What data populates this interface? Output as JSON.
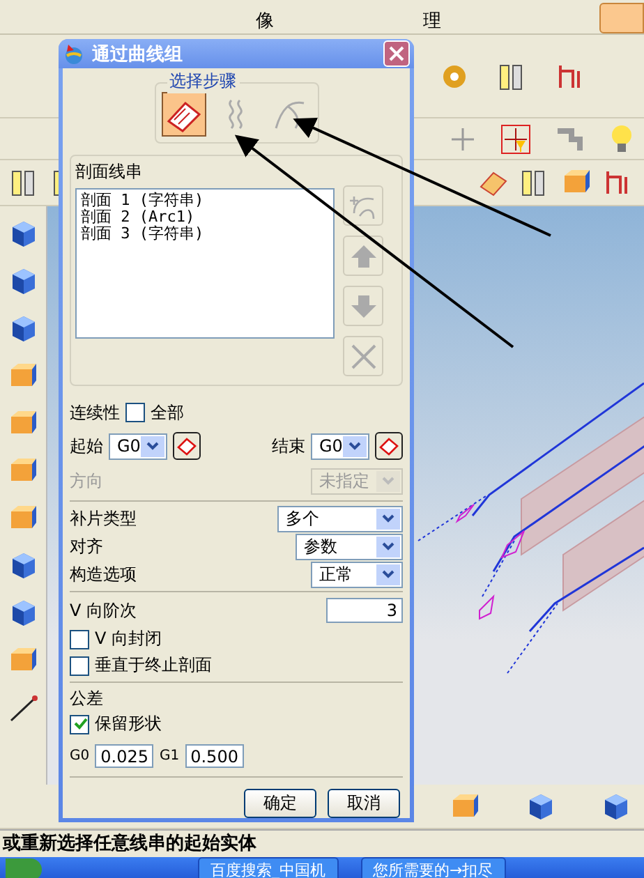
{
  "app": {
    "ribbon_labels": [
      "像",
      "理"
    ],
    "status_text": "或重新选择任意线串的起始实体",
    "taskbar_items": [
      "百度搜索_中国机",
      "您所需要的→扣尽"
    ]
  },
  "dialog": {
    "title": "通过曲线组",
    "steps": {
      "label": "选择步骤",
      "items": [
        {
          "kind": "sheet",
          "selected": true
        },
        {
          "kind": "curves",
          "selected": false
        },
        {
          "kind": "spine",
          "selected": false
        }
      ]
    },
    "sections": {
      "label": "剖面线串",
      "items": [
        "剖面 1 (字符串)",
        "剖面 2 (Arc1)",
        "剖面 3 (字符串)"
      ],
      "side_buttons": [
        {
          "kind": "add",
          "disabled": true
        },
        {
          "kind": "up",
          "disabled": true
        },
        {
          "kind": "down",
          "disabled": true
        },
        {
          "kind": "remove",
          "disabled": true
        }
      ]
    },
    "continuity": {
      "label": "连续性",
      "all": {
        "label": "全部",
        "checked": false
      },
      "start": {
        "label": "起始",
        "value": "G0"
      },
      "end": {
        "label": "结束",
        "value": "G0"
      }
    },
    "direction": {
      "label": "方向",
      "value": "未指定",
      "disabled": true
    },
    "options": [
      {
        "label": "补片类型",
        "value": "多个"
      },
      {
        "label": "对齐",
        "value": "参数"
      },
      {
        "label": "构造选项",
        "value": "正常"
      }
    ],
    "v_degree": {
      "label": "V 向阶次",
      "value": "3"
    },
    "checkboxes": [
      {
        "label": "V 向封闭",
        "checked": false
      },
      {
        "label": "垂直于终止剖面",
        "checked": false
      }
    ],
    "tolerance": {
      "label": "公差",
      "keep_shape": {
        "label": "保留形状",
        "checked": true
      },
      "g0": {
        "label": "G0",
        "value": "0.025"
      },
      "g1": {
        "label": "G1",
        "value": "0.500"
      }
    },
    "buttons": [
      "确定",
      "取消"
    ]
  }
}
